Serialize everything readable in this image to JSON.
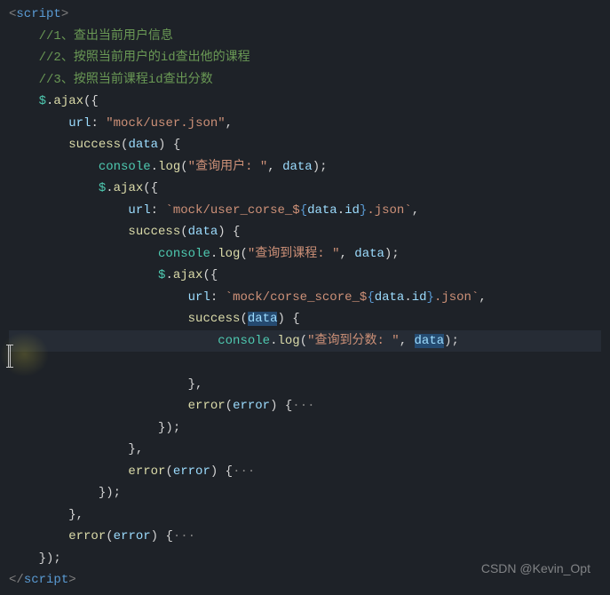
{
  "tag_open_bracket": "<",
  "tag_close_bracket": ">",
  "tag_end_open": "</",
  "tag_name": "script",
  "comment1": "//1、查出当前用户信息",
  "comment2": "//2、按照当前用户的id查出他的课程",
  "comment3": "//3、按照当前课程id查出分数",
  "jq": "$",
  "ajax": "ajax",
  "url_key": "url",
  "colon": ":",
  "success_key": "success",
  "error_key": "error",
  "data_param": "data",
  "error_param": "error",
  "console": "console",
  "log": "log",
  "url1": "\"mock/user.json\"",
  "url2_pre": "`mock/user_corse_$",
  "url2_expr_open": "{",
  "url2_expr_obj": "data",
  "url2_expr_prop": "id",
  "url2_expr_close": "}",
  "url2_post": ".json`",
  "url3_pre": "`mock/corse_score_$",
  "url3_post": ".json`",
  "log1_str": "\"查询用户: \"",
  "log2_str": "\"查询到课程: \"",
  "log3_str": "\"查询到分数: \"",
  "fold": "···",
  "watermark": "CSDN @Kevin_Opt"
}
